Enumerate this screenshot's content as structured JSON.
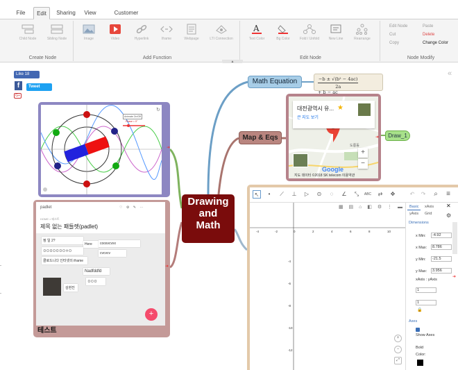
{
  "tabs": [
    "File",
    "Edit",
    "Sharing",
    "View",
    "Customer Center"
  ],
  "active_tab": "Edit",
  "ribbon": {
    "create_node": {
      "label": "Create Node",
      "buttons": [
        "Child Node",
        "Sibling Node"
      ]
    },
    "add_function": {
      "label": "Add Function",
      "buttons": [
        "Image",
        "Video",
        "Hyperlink",
        "Iframe",
        "Webpage",
        "LTI Connection"
      ]
    },
    "edit_node": {
      "label": "Edit Node",
      "buttons": [
        "Text Color",
        "Bg Color",
        "Fold / Unfold",
        "New Line",
        "Rearrange"
      ]
    },
    "node_modify": {
      "label": "Node Modify",
      "items": [
        "Edit Node",
        "Paste",
        "Cut",
        "Delete",
        "Copy",
        "Change Color"
      ]
    }
  },
  "social": {
    "like": "Like 18",
    "fb": "f",
    "tweet": "Tweet",
    "gplus": "G+"
  },
  "mindmap": {
    "central": "Drawing\nand\nMath",
    "math_equation": "Math Equation",
    "map_eqs": "Map & Eqs",
    "draw": "Draw_1",
    "equation": {
      "numerator": "−b ± √(b² − 4ac)",
      "denominator": "2a",
      "rest": "+ b − ac"
    }
  },
  "map": {
    "place": "대전광역시 유...",
    "link": "큰 지도 보기",
    "zoom_in": "+",
    "zoom_out": "−",
    "logo": "Google",
    "copyright": "지도 데이터 ©2018 SK telecom   이용약관",
    "label_do": "도룡동"
  },
  "phasor": {
    "callout_1": "Animate On/Off",
    "callout_2": "Phase = 0°"
  },
  "padlet": {
    "owner": "padlet",
    "path": "HOME > 테스트",
    "title": "제목 없는 패들렛(padlet)",
    "notes": [
      "정 일 2?",
      "Here",
      "coosvcvxx",
      "ㅁㅁㅁㅁㅁㅁㅁㅇㅁ",
      "cvcvcv",
      "클로드니다 인터넷의 iframe",
      "Nadfddfd",
      "김현진",
      "ㅁㅁㅁ"
    ],
    "caption": "테스트",
    "fab": "+"
  },
  "geogebra": {
    "tabs": [
      "Basic",
      "xAxis",
      "yAxis",
      "Grid"
    ],
    "section": "Dimensions",
    "fields": [
      {
        "label": "x Min:",
        "value": "-4.92"
      },
      {
        "label": "x Max:",
        "value": "8.786"
      },
      {
        "label": "y Min:",
        "value": "-21.5"
      },
      {
        "label": "y Max:",
        "value": "3.956"
      }
    ],
    "xaxis_yaxis": "xAxis : yAxis",
    "ratio_1": "1",
    "ratio_2": "1",
    "axes": "Axes",
    "show_axes": "Show Axes",
    "bold": "Bold",
    "color": "Color:",
    "x_ticks": [
      "-4",
      "-2",
      "0",
      "2",
      "4",
      "6",
      "8",
      "10"
    ],
    "y_ticks": [
      "-4",
      "-6",
      "-8",
      "-10",
      "-12"
    ]
  }
}
